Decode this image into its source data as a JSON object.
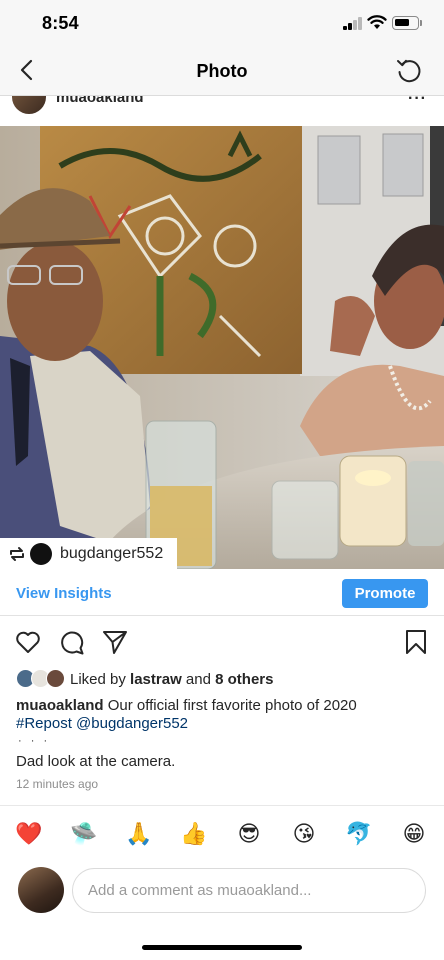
{
  "status_bar": {
    "time": "8:54"
  },
  "nav": {
    "title": "Photo"
  },
  "post": {
    "username": "muaoakland",
    "more": "···",
    "repost_from": "bugdanger552"
  },
  "insights": {
    "view_label": "View Insights",
    "promote_label": "Promote"
  },
  "likes": {
    "prefix": "Liked by",
    "user": "lastraw",
    "middle": "and",
    "others": "8 others"
  },
  "caption": {
    "username": "muaoakland",
    "text": "Our official first favorite photo of 2020",
    "repost_tag": "#Repost @bugdanger552",
    "dots": "· · ·",
    "extra": "Dad look at the camera.",
    "timestamp": "12 minutes ago"
  },
  "reactions": [
    "❤️",
    "🛸",
    "🙏",
    "👍",
    "😎",
    "😘",
    "🐬",
    "😁"
  ],
  "comment": {
    "placeholder": "Add a comment as muaoakland..."
  },
  "colors": {
    "accent": "#3897f0",
    "link": "#003569",
    "meta": "#8e8e8e"
  }
}
